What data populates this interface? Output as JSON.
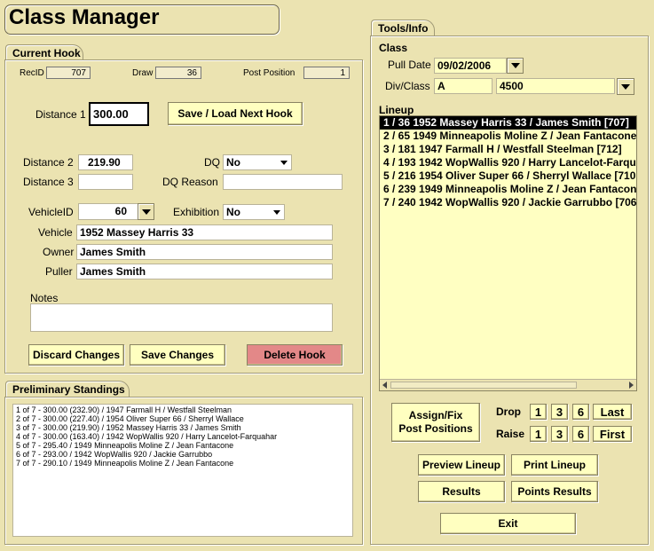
{
  "app_title": "Class Manager",
  "current_hook": {
    "tab_label": "Current Hook",
    "recid_label": "RecID",
    "recid_value": "707",
    "draw_label": "Draw",
    "draw_value": "36",
    "post_position_label": "Post Position",
    "post_position_value": "1",
    "distance1_label": "Distance 1",
    "distance1_value": "300.00",
    "save_load_next_label": "Save / Load Next Hook",
    "distance2_label": "Distance 2",
    "distance2_value": "219.90",
    "distance3_label": "Distance 3",
    "distance3_value": "",
    "dq_label": "DQ",
    "dq_value": "No",
    "dq_reason_label": "DQ Reason",
    "dq_reason_value": "",
    "vehicleid_label": "VehicleID",
    "vehicleid_value": "60",
    "exhibition_label": "Exhibition",
    "exhibition_value": "No",
    "vehicle_label": "Vehicle",
    "vehicle_value": "1952 Massey Harris 33",
    "owner_label": "Owner",
    "owner_value": "James Smith",
    "puller_label": "Puller",
    "puller_value": "James Smith",
    "notes_label": "Notes",
    "notes_value": "",
    "discard_label": "Discard Changes",
    "save_label": "Save Changes",
    "delete_label": "Delete Hook"
  },
  "standings": {
    "tab_label": "Preliminary Standings",
    "items": [
      "1 of 7 - 300.00 (232.90) / 1947 Farmall H / Westfall Steelman",
      "2 of 7 - 300.00 (227.40) / 1954 Oliver Super 66 / Sherryl Wallace",
      "3 of 7 - 300.00 (219.90) / 1952 Massey Harris 33 / James Smith",
      "4 of 7 - 300.00 (163.40) / 1942 WopWallis 920 / Harry Lancelot-Farquahar",
      "5 of 7 - 295.40 / 1949 Minneapolis Moline Z / Jean Fantacone",
      "6 of 7 - 293.00 / 1942 WopWallis 920 / Jackie Garrubbo",
      "7 of 7 - 290.10 / 1949 Minneapolis Moline Z / Jean Fantacone"
    ]
  },
  "tools": {
    "tab_label": "Tools/Info",
    "class_label": "Class",
    "pull_date_label": "Pull Date",
    "pull_date_value": "09/02/2006",
    "divclass_label": "Div/Class",
    "div_value": "A",
    "class_value": "4500",
    "lineup_label": "Lineup",
    "lineup_items": [
      "1 / 36 1952 Massey Harris 33 / James Smith [707]",
      "2 / 65 1949 Minneapolis Moline Z / Jean Fantacone [",
      "3 / 181 1947 Farmall H / Westfall Steelman [712]",
      "4 / 193 1942 WopWallis 920 / Harry Lancelot-Farqua",
      "5 / 216 1954 Oliver Super 66 / Sherryl Wallace [710",
      "6 / 239 1949 Minneapolis Moline Z / Jean Fantacone",
      "7 / 240 1942 WopWallis 920 / Jackie Garrubbo [706"
    ],
    "assign_line1": "Assign/Fix",
    "assign_line2": "Post Positions",
    "drop_label": "Drop",
    "raise_label": "Raise",
    "drop_buttons": [
      "1",
      "3",
      "6",
      "Last"
    ],
    "raise_buttons": [
      "1",
      "3",
      "6",
      "First"
    ],
    "preview_lineup_label": "Preview Lineup",
    "print_lineup_label": "Print Lineup",
    "results_label": "Results",
    "points_results_label": "Points Results",
    "exit_label": "Exit"
  }
}
